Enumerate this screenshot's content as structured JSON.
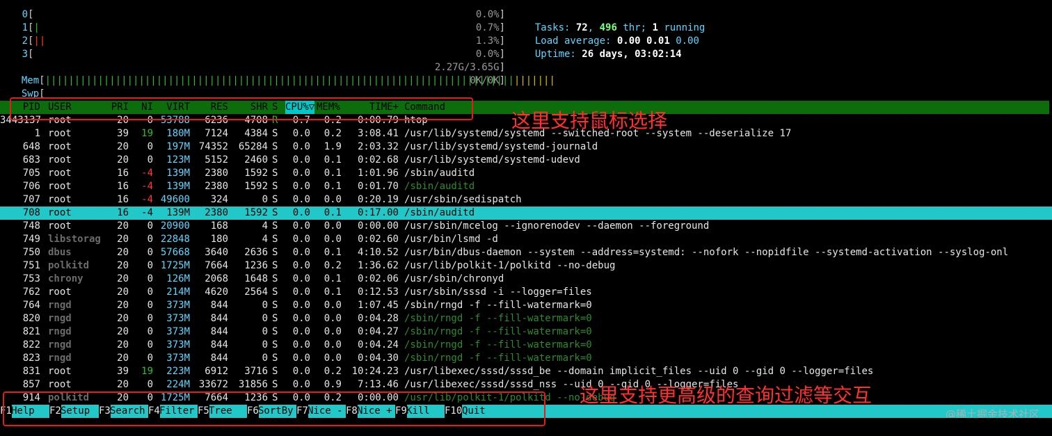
{
  "meters": {
    "cpus": [
      {
        "label": "0",
        "bars": "",
        "bar_color": "green",
        "value": "0.0%"
      },
      {
        "label": "1",
        "bars": "|",
        "bar_color": "green",
        "value": "0.7%"
      },
      {
        "label": "2",
        "bars": "||",
        "bar_color": "red",
        "value": "1.3%"
      },
      {
        "label": "3",
        "bars": "",
        "bar_color": "green",
        "value": "0.0%"
      }
    ],
    "mem": {
      "label": "Mem",
      "bars_green": "||||||||||||||||||||||||||||||||||||||||||||||||||||||||||||||||||||||||||||||||",
      "bars_yellow": "|||||||",
      "value": "2.27G/3.65G"
    },
    "swp": {
      "label": "Swp",
      "value": "0K/0K"
    }
  },
  "stats": {
    "tasks_label": "Tasks: ",
    "tasks": "72",
    "thr_count": "496",
    "thr_label": " thr; ",
    "running": "1",
    "running_label": " running",
    "load_label": "Load average: ",
    "load1": "0.00",
    "load5": "0.01",
    "load15": "0.00",
    "uptime_label": "Uptime: ",
    "uptime": "26 days, 03:02:14"
  },
  "header": {
    "pid": "PID",
    "user": "USER",
    "pri": "PRI",
    "ni": "NI",
    "virt": "VIRT",
    "res": "RES",
    "shr": "SHR",
    "s": "S",
    "cpu": "CPU%▽",
    "mem": "MEM%",
    "time": "TIME+",
    "command": "Command"
  },
  "processes": [
    {
      "pid": "3443137",
      "user": "root",
      "pri": "20",
      "ni": "0",
      "virt": "53788",
      "res": "6236",
      "shr": "4708",
      "s": "R",
      "cpu": "0.7",
      "mem": "0.2",
      "time": "0:00.79",
      "cmd": "htop"
    },
    {
      "pid": "1",
      "user": "root",
      "pri": "39",
      "ni": "19",
      "virt": "180M",
      "res": "7124",
      "shr": "4384",
      "s": "S",
      "cpu": "0.0",
      "mem": "0.2",
      "time": "3:08.41",
      "cmd": "/usr/lib/systemd/systemd --switched-root --system --deserialize 17"
    },
    {
      "pid": "648",
      "user": "root",
      "pri": "20",
      "ni": "0",
      "virt": "197M",
      "res": "74352",
      "shr": "65284",
      "s": "S",
      "cpu": "0.0",
      "mem": "1.9",
      "time": "2:03.32",
      "cmd": "/usr/lib/systemd/systemd-journald"
    },
    {
      "pid": "683",
      "user": "root",
      "pri": "20",
      "ni": "0",
      "virt": "123M",
      "res": "5152",
      "shr": "2460",
      "s": "S",
      "cpu": "0.0",
      "mem": "0.1",
      "time": "0:02.68",
      "cmd": "/usr/lib/systemd/systemd-udevd"
    },
    {
      "pid": "705",
      "user": "root",
      "pri": "16",
      "ni": "-4",
      "virt": "139M",
      "res": "2380",
      "shr": "1592",
      "s": "S",
      "cpu": "0.0",
      "mem": "0.1",
      "time": "1:01.96",
      "cmd": "/sbin/auditd"
    },
    {
      "pid": "706",
      "user": "root",
      "pri": "16",
      "ni": "-4",
      "virt": "139M",
      "res": "2380",
      "shr": "1592",
      "s": "S",
      "cpu": "0.0",
      "mem": "0.1",
      "time": "0:01.70",
      "cmd": "/sbin/auditd"
    },
    {
      "pid": "707",
      "user": "root",
      "pri": "16",
      "ni": "-4",
      "virt": "49600",
      "res": "324",
      "shr": "0",
      "s": "S",
      "cpu": "0.0",
      "mem": "0.0",
      "time": "0:20.19",
      "cmd": "/usr/sbin/sedispatch"
    },
    {
      "pid": "708",
      "user": "root",
      "pri": "16",
      "ni": "-4",
      "virt": "139M",
      "res": "2380",
      "shr": "1592",
      "s": "S",
      "cpu": "0.0",
      "mem": "0.1",
      "time": "0:17.00",
      "cmd": "/sbin/auditd"
    },
    {
      "pid": "748",
      "user": "root",
      "pri": "20",
      "ni": "0",
      "virt": "20900",
      "res": "168",
      "shr": "4",
      "s": "S",
      "cpu": "0.0",
      "mem": "0.0",
      "time": "0:00.00",
      "cmd": "/usr/sbin/mcelog --ignorenodev --daemon --foreground"
    },
    {
      "pid": "749",
      "user": "libstorag",
      "pri": "20",
      "ni": "0",
      "virt": "22848",
      "res": "180",
      "shr": "4",
      "s": "S",
      "cpu": "0.0",
      "mem": "0.0",
      "time": "0:02.60",
      "cmd": "/usr/bin/lsmd -d"
    },
    {
      "pid": "750",
      "user": "dbus",
      "pri": "20",
      "ni": "0",
      "virt": "57668",
      "res": "3640",
      "shr": "2636",
      "s": "S",
      "cpu": "0.0",
      "mem": "0.1",
      "time": "4:10.52",
      "cmd": "/usr/bin/dbus-daemon --system --address=systemd: --nofork --nopidfile --systemd-activation --syslog-onl"
    },
    {
      "pid": "751",
      "user": "polkitd",
      "pri": "20",
      "ni": "0",
      "virt": "1725M",
      "res": "7664",
      "shr": "1236",
      "s": "S",
      "cpu": "0.0",
      "mem": "0.2",
      "time": "1:36.62",
      "cmd": "/usr/lib/polkit-1/polkitd --no-debug"
    },
    {
      "pid": "753",
      "user": "chrony",
      "pri": "20",
      "ni": "0",
      "virt": "126M",
      "res": "2068",
      "shr": "1648",
      "s": "S",
      "cpu": "0.0",
      "mem": "0.1",
      "time": "0:02.06",
      "cmd": "/usr/sbin/chronyd"
    },
    {
      "pid": "762",
      "user": "root",
      "pri": "20",
      "ni": "0",
      "virt": "214M",
      "res": "4620",
      "shr": "2564",
      "s": "S",
      "cpu": "0.0",
      "mem": "0.1",
      "time": "0:12.53",
      "cmd": "/usr/sbin/sssd -i --logger=files"
    },
    {
      "pid": "764",
      "user": "rngd",
      "pri": "20",
      "ni": "0",
      "virt": "373M",
      "res": "844",
      "shr": "0",
      "s": "S",
      "cpu": "0.0",
      "mem": "0.0",
      "time": "1:07.45",
      "cmd": "/sbin/rngd -f --fill-watermark=0"
    },
    {
      "pid": "820",
      "user": "rngd",
      "pri": "20",
      "ni": "0",
      "virt": "373M",
      "res": "844",
      "shr": "0",
      "s": "S",
      "cpu": "0.0",
      "mem": "0.0",
      "time": "0:04.28",
      "cmd": "/sbin/rngd -f --fill-watermark=0"
    },
    {
      "pid": "821",
      "user": "rngd",
      "pri": "20",
      "ni": "0",
      "virt": "373M",
      "res": "844",
      "shr": "0",
      "s": "S",
      "cpu": "0.0",
      "mem": "0.0",
      "time": "0:04.27",
      "cmd": "/sbin/rngd -f --fill-watermark=0"
    },
    {
      "pid": "822",
      "user": "rngd",
      "pri": "20",
      "ni": "0",
      "virt": "373M",
      "res": "844",
      "shr": "0",
      "s": "S",
      "cpu": "0.0",
      "mem": "0.0",
      "time": "0:04.24",
      "cmd": "/sbin/rngd -f --fill-watermark=0"
    },
    {
      "pid": "823",
      "user": "rngd",
      "pri": "20",
      "ni": "0",
      "virt": "373M",
      "res": "844",
      "shr": "0",
      "s": "S",
      "cpu": "0.0",
      "mem": "0.0",
      "time": "0:04.30",
      "cmd": "/sbin/rngd -f --fill-watermark=0"
    },
    {
      "pid": "831",
      "user": "root",
      "pri": "39",
      "ni": "19",
      "virt": "223M",
      "res": "6912",
      "shr": "3716",
      "s": "S",
      "cpu": "0.0",
      "mem": "0.2",
      "time": "10:24.23",
      "cmd": "/usr/libexec/sssd/sssd_be --domain implicit_files --uid 0 --gid 0 --logger=files"
    },
    {
      "pid": "857",
      "user": "root",
      "pri": "20",
      "ni": "0",
      "virt": "224M",
      "res": "33672",
      "shr": "31856",
      "s": "S",
      "cpu": "0.0",
      "mem": "0.9",
      "time": "7:13.46",
      "cmd": "/usr/libexec/sssd/sssd_nss --uid 0 --gid 0 --logger=files"
    },
    {
      "pid": "914",
      "user": "polkitd",
      "pri": "20",
      "ni": "0",
      "virt": "1725M",
      "res": "7664",
      "shr": "1236",
      "s": "S",
      "cpu": "0.0",
      "mem": "0.2",
      "time": "0:00.00",
      "cmd": "/usr/lib/polkit-1/polkitd --no-debug"
    }
  ],
  "footer": [
    {
      "key": "F1",
      "label": "Help  "
    },
    {
      "key": "F2",
      "label": "Setup "
    },
    {
      "key": "F3",
      "label": "Search"
    },
    {
      "key": "F4",
      "label": "Filter"
    },
    {
      "key": "F5",
      "label": "Tree  "
    },
    {
      "key": "F6",
      "label": "SortBy"
    },
    {
      "key": "F7",
      "label": "Nice -"
    },
    {
      "key": "F8",
      "label": "Nice +"
    },
    {
      "key": "F9",
      "label": "Kill  "
    },
    {
      "key": "F10",
      "label": "Quit  "
    }
  ],
  "annotations": {
    "mouse_select": "这里支持鼠标选择",
    "advanced_filter": "这里支持更高级的查询过滤等交互"
  },
  "watermark": "@稀土掘金技术社区"
}
